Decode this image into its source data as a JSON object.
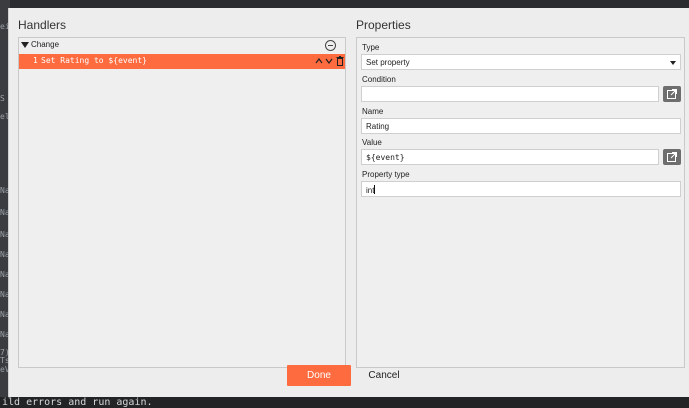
{
  "background": {
    "fragments": [
      "ei",
      "S",
      "el",
      "Na",
      "Na",
      "Na",
      "Na",
      "Na",
      "Na",
      "Na",
      "Na",
      "7)",
      "Ts",
      "eV"
    ],
    "console_line": "ild errors and run again."
  },
  "dialog": {
    "handlers_title": "Handlers",
    "properties_title": "Properties",
    "handler_group": "Change",
    "action": {
      "number": "1",
      "text": "Set Rating to ${event}"
    },
    "fields": {
      "type": {
        "label": "Type",
        "value": "Set property"
      },
      "condition": {
        "label": "Condition",
        "value": ""
      },
      "name": {
        "label": "Name",
        "value": "Rating"
      },
      "value": {
        "label": "Value",
        "value": "${event}"
      },
      "property_type": {
        "label": "Property type",
        "value": "int"
      }
    },
    "done_label": "Done",
    "cancel_label": "Cancel"
  },
  "colors": {
    "accent": "#fe6b3f",
    "dialog_bg": "#ededed"
  }
}
